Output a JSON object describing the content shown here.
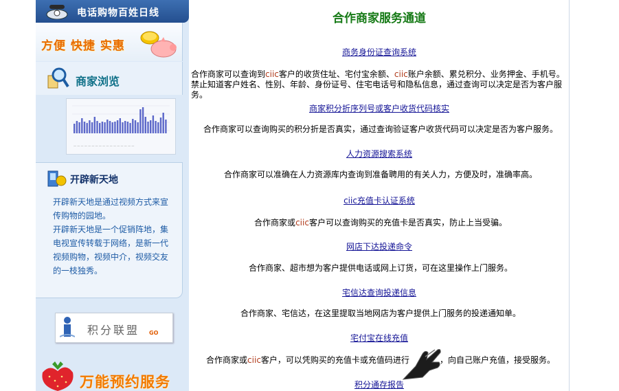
{
  "sidebar": {
    "hotline": "电话购物百姓日线",
    "slogan": "方便 快捷 实惠",
    "browse_title": "商家浏览",
    "newland": {
      "title": "开辟新天地",
      "para1": "开辟新天地是通过视频方式来宣传购物的园地。",
      "para2": "开辟新天地是一个促销阵地，集电视宣传转载于网络，是新一代视频购物，视频中介，视频交友的一枝独秀。"
    },
    "jifen_banner": "积分联盟",
    "jifen_go": "GO",
    "wanneng": "万能预约服务"
  },
  "main": {
    "title": "合作商家服务通道",
    "services": [
      {
        "link": "商务身份证查询系统",
        "desc_parts": [
          "合作商家可以查询到",
          "ciic",
          "客户的收货住址、宅付宝余额、",
          "ciic",
          "账户余额、累兑积分、业务押金、手机号。禁止知道客户姓名、性别、年龄、身份证号、住宅电话号和隐私信息，通过查询可以决定是否为客户服务。"
        ]
      },
      {
        "link": "商家积分折序列号或客户收货代码核实",
        "desc": "合作商家可以查询购买的积分折是否真实，通过查询验证客户收货代码可以决定是否为客户服务。"
      },
      {
        "link": "人力资源搜索系统",
        "desc": "合作商家可以准确在人力资源库内查询到准备聘用的有关人力，方便及时，准确率高。"
      },
      {
        "link": "ciic充值卡认证系统",
        "desc_parts": [
          "合作商家或",
          "ciic",
          "客户可以查询购买的充值卡是否真实，防止上当受骗。"
        ]
      },
      {
        "link": "网店下达投递命令",
        "desc": "合作商家、超市想为客户提供电话或网上订货，可在这里操作上门服务。"
      },
      {
        "link": "宅信达查询投递信息",
        "desc": "合作商家、宅信达，在这里提取当地网店为客户提供上门服务的投递通知单。"
      },
      {
        "link": "宅付宝在线充值",
        "desc_parts": [
          "合作商家或",
          "ciic",
          "客户，可以凭购买的充值卡或充值码进行",
          "",
          "，向自己账户充值，接受服务。"
        ]
      },
      {
        "link": "积分通存报告"
      }
    ]
  },
  "colors": {
    "title_green": "#167a16",
    "link_blue": "#141496",
    "sidebar_bg": "#dce9f7",
    "accent_orange": "#e86c00",
    "ciic_red": "#b03a1a"
  },
  "icons": [
    "phone-icon",
    "coin-pig-icon",
    "magnifier-icon",
    "newland-icon",
    "person-icon",
    "strawberry-icon",
    "pointer-hand-icon"
  ]
}
